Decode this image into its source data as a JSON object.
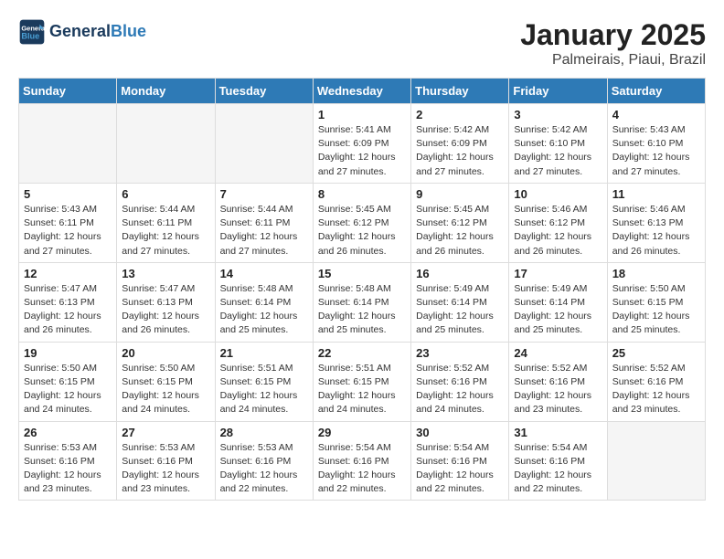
{
  "header": {
    "logo_line1": "General",
    "logo_line2": "Blue",
    "month": "January 2025",
    "location": "Palmeirais, Piaui, Brazil"
  },
  "weekdays": [
    "Sunday",
    "Monday",
    "Tuesday",
    "Wednesday",
    "Thursday",
    "Friday",
    "Saturday"
  ],
  "weeks": [
    [
      {
        "day": "",
        "info": ""
      },
      {
        "day": "",
        "info": ""
      },
      {
        "day": "",
        "info": ""
      },
      {
        "day": "1",
        "info": "Sunrise: 5:41 AM\nSunset: 6:09 PM\nDaylight: 12 hours\nand 27 minutes."
      },
      {
        "day": "2",
        "info": "Sunrise: 5:42 AM\nSunset: 6:09 PM\nDaylight: 12 hours\nand 27 minutes."
      },
      {
        "day": "3",
        "info": "Sunrise: 5:42 AM\nSunset: 6:10 PM\nDaylight: 12 hours\nand 27 minutes."
      },
      {
        "day": "4",
        "info": "Sunrise: 5:43 AM\nSunset: 6:10 PM\nDaylight: 12 hours\nand 27 minutes."
      }
    ],
    [
      {
        "day": "5",
        "info": "Sunrise: 5:43 AM\nSunset: 6:11 PM\nDaylight: 12 hours\nand 27 minutes."
      },
      {
        "day": "6",
        "info": "Sunrise: 5:44 AM\nSunset: 6:11 PM\nDaylight: 12 hours\nand 27 minutes."
      },
      {
        "day": "7",
        "info": "Sunrise: 5:44 AM\nSunset: 6:11 PM\nDaylight: 12 hours\nand 27 minutes."
      },
      {
        "day": "8",
        "info": "Sunrise: 5:45 AM\nSunset: 6:12 PM\nDaylight: 12 hours\nand 26 minutes."
      },
      {
        "day": "9",
        "info": "Sunrise: 5:45 AM\nSunset: 6:12 PM\nDaylight: 12 hours\nand 26 minutes."
      },
      {
        "day": "10",
        "info": "Sunrise: 5:46 AM\nSunset: 6:12 PM\nDaylight: 12 hours\nand 26 minutes."
      },
      {
        "day": "11",
        "info": "Sunrise: 5:46 AM\nSunset: 6:13 PM\nDaylight: 12 hours\nand 26 minutes."
      }
    ],
    [
      {
        "day": "12",
        "info": "Sunrise: 5:47 AM\nSunset: 6:13 PM\nDaylight: 12 hours\nand 26 minutes."
      },
      {
        "day": "13",
        "info": "Sunrise: 5:47 AM\nSunset: 6:13 PM\nDaylight: 12 hours\nand 26 minutes."
      },
      {
        "day": "14",
        "info": "Sunrise: 5:48 AM\nSunset: 6:14 PM\nDaylight: 12 hours\nand 25 minutes."
      },
      {
        "day": "15",
        "info": "Sunrise: 5:48 AM\nSunset: 6:14 PM\nDaylight: 12 hours\nand 25 minutes."
      },
      {
        "day": "16",
        "info": "Sunrise: 5:49 AM\nSunset: 6:14 PM\nDaylight: 12 hours\nand 25 minutes."
      },
      {
        "day": "17",
        "info": "Sunrise: 5:49 AM\nSunset: 6:14 PM\nDaylight: 12 hours\nand 25 minutes."
      },
      {
        "day": "18",
        "info": "Sunrise: 5:50 AM\nSunset: 6:15 PM\nDaylight: 12 hours\nand 25 minutes."
      }
    ],
    [
      {
        "day": "19",
        "info": "Sunrise: 5:50 AM\nSunset: 6:15 PM\nDaylight: 12 hours\nand 24 minutes."
      },
      {
        "day": "20",
        "info": "Sunrise: 5:50 AM\nSunset: 6:15 PM\nDaylight: 12 hours\nand 24 minutes."
      },
      {
        "day": "21",
        "info": "Sunrise: 5:51 AM\nSunset: 6:15 PM\nDaylight: 12 hours\nand 24 minutes."
      },
      {
        "day": "22",
        "info": "Sunrise: 5:51 AM\nSunset: 6:15 PM\nDaylight: 12 hours\nand 24 minutes."
      },
      {
        "day": "23",
        "info": "Sunrise: 5:52 AM\nSunset: 6:16 PM\nDaylight: 12 hours\nand 24 minutes."
      },
      {
        "day": "24",
        "info": "Sunrise: 5:52 AM\nSunset: 6:16 PM\nDaylight: 12 hours\nand 23 minutes."
      },
      {
        "day": "25",
        "info": "Sunrise: 5:52 AM\nSunset: 6:16 PM\nDaylight: 12 hours\nand 23 minutes."
      }
    ],
    [
      {
        "day": "26",
        "info": "Sunrise: 5:53 AM\nSunset: 6:16 PM\nDaylight: 12 hours\nand 23 minutes."
      },
      {
        "day": "27",
        "info": "Sunrise: 5:53 AM\nSunset: 6:16 PM\nDaylight: 12 hours\nand 23 minutes."
      },
      {
        "day": "28",
        "info": "Sunrise: 5:53 AM\nSunset: 6:16 PM\nDaylight: 12 hours\nand 22 minutes."
      },
      {
        "day": "29",
        "info": "Sunrise: 5:54 AM\nSunset: 6:16 PM\nDaylight: 12 hours\nand 22 minutes."
      },
      {
        "day": "30",
        "info": "Sunrise: 5:54 AM\nSunset: 6:16 PM\nDaylight: 12 hours\nand 22 minutes."
      },
      {
        "day": "31",
        "info": "Sunrise: 5:54 AM\nSunset: 6:16 PM\nDaylight: 12 hours\nand 22 minutes."
      },
      {
        "day": "",
        "info": ""
      }
    ]
  ]
}
